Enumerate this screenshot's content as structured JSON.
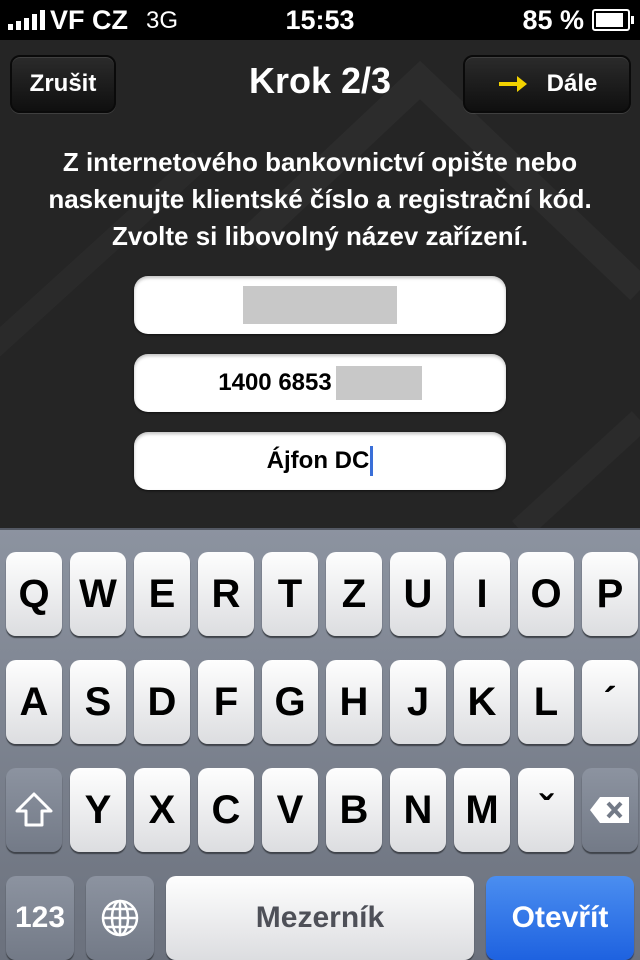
{
  "status": {
    "carrier": "VF CZ",
    "network": "3G",
    "time": "15:53",
    "battery": "85 %",
    "battery_level": 0.85
  },
  "nav": {
    "cancel_label": "Zrušit",
    "title": "Krok 2/3",
    "next_label": "Dále",
    "next_icon": "arrow-right-icon",
    "accent": "#f2d200"
  },
  "instructions": "Z internetového bankovnictví opište nebo naskenujte klientské číslo a registrační kód. Zvolte si libovolný název zařízení.",
  "fields": {
    "client_number": "",
    "registration_code": "1400 6853",
    "device_name": "Ájfon DC"
  },
  "keyboard": {
    "row1": [
      "Q",
      "W",
      "E",
      "R",
      "T",
      "Z",
      "U",
      "I",
      "O",
      "P"
    ],
    "row2": [
      "A",
      "S",
      "D",
      "F",
      "G",
      "H",
      "J",
      "K",
      "L",
      "´"
    ],
    "row3": [
      "Y",
      "X",
      "C",
      "V",
      "B",
      "N",
      "M",
      "ˇ"
    ],
    "numbers_label": "123",
    "space_label": "Mezerník",
    "return_label": "Otevřít",
    "return_color": "#2a6de6"
  }
}
